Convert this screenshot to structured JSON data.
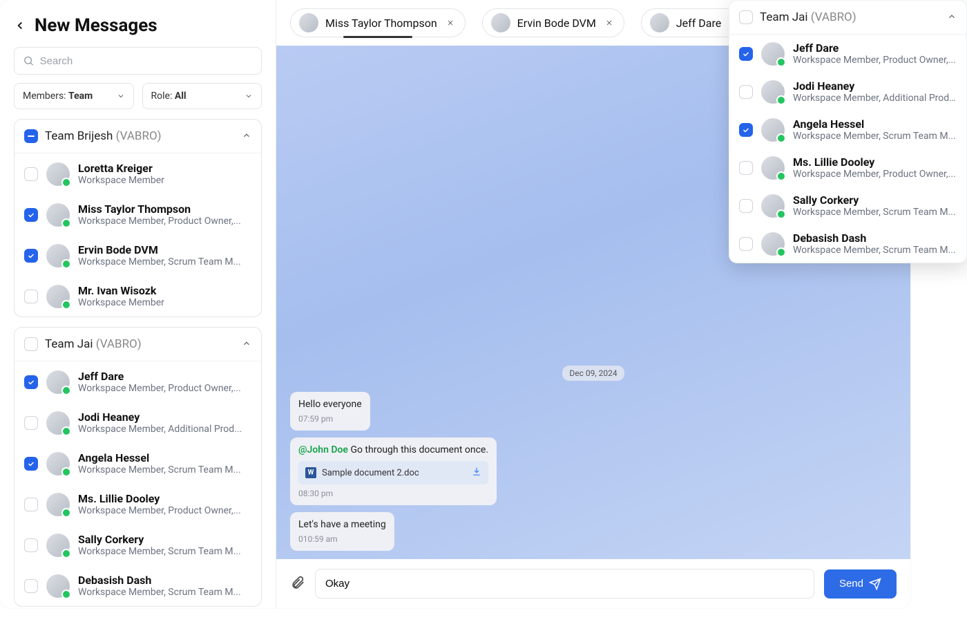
{
  "sidebar": {
    "title": "New Messages",
    "search_placeholder": "Search",
    "filter_members_prefix": "Members: ",
    "filter_members_value": "Team",
    "filter_role_prefix": "Role: ",
    "filter_role_value": "All"
  },
  "groups": [
    {
      "name": "Team Brijesh",
      "org": "(VABRO)",
      "state": "indeterminate",
      "members": [
        {
          "name": "Loretta Kreiger",
          "role": "Workspace Member",
          "checked": false
        },
        {
          "name": "Miss Taylor Thompson",
          "role": "Workspace Member, Product Owner,...",
          "checked": true
        },
        {
          "name": "Ervin Bode DVM",
          "role": "Workspace Member, Scrum Team M...",
          "checked": true
        },
        {
          "name": "Mr. Ivan Wisozk",
          "role": "Workspace Member",
          "checked": false
        }
      ]
    },
    {
      "name": "Team Jai",
      "org": "(VABRO)",
      "state": "unchecked",
      "members": [
        {
          "name": "Jeff Dare",
          "role": "Workspace Member, Product Owner,...",
          "checked": true
        },
        {
          "name": "Jodi Heaney",
          "role": "Workspace Member, Additional Prod...",
          "checked": false
        },
        {
          "name": "Angela Hessel",
          "role": "Workspace Member, Scrum Team M...",
          "checked": true
        },
        {
          "name": "Ms. Lillie Dooley",
          "role": "Workspace Member, Product Owner,...",
          "checked": false
        },
        {
          "name": "Sally Corkery",
          "role": "Workspace Member, Scrum Team M...",
          "checked": false
        },
        {
          "name": "Debasish Dash",
          "role": "Workspace Member, Scrum Team M...",
          "checked": false
        }
      ]
    }
  ],
  "tabs": [
    {
      "name": "Miss Taylor Thompson",
      "active": true
    },
    {
      "name": "Ervin Bode DVM",
      "active": false
    },
    {
      "name": "Jeff Dare",
      "active": false
    }
  ],
  "chat": {
    "date": "Dec 09, 2024",
    "messages": [
      {
        "text": "Hello everyone",
        "time": "07:59 pm"
      },
      {
        "mention": "@John Doe",
        "text": " Go through this document once.",
        "doc": "Sample document 2.doc",
        "time": "08:30 pm"
      },
      {
        "text": "Let's have a meeting",
        "time": "010:59 am"
      }
    ],
    "input_value": "Okay",
    "send_label": "Send"
  },
  "popover": {
    "title": "Team Jai",
    "org": "(VABRO)",
    "members": [
      {
        "name": "Jeff Dare",
        "role": "Workspace Member, Product Owner,...",
        "checked": true
      },
      {
        "name": "Jodi Heaney",
        "role": "Workspace Member, Additional Prod...",
        "checked": false
      },
      {
        "name": "Angela Hessel",
        "role": "Workspace Member, Scrum Team M...",
        "checked": true
      },
      {
        "name": "Ms. Lillie Dooley",
        "role": "Workspace Member, Product Owner,...",
        "checked": false
      },
      {
        "name": "Sally Corkery",
        "role": "Workspace Member, Scrum Team M...",
        "checked": false
      },
      {
        "name": "Debasish Dash",
        "role": "Workspace Member, Scrum Team M...",
        "checked": false
      }
    ]
  }
}
